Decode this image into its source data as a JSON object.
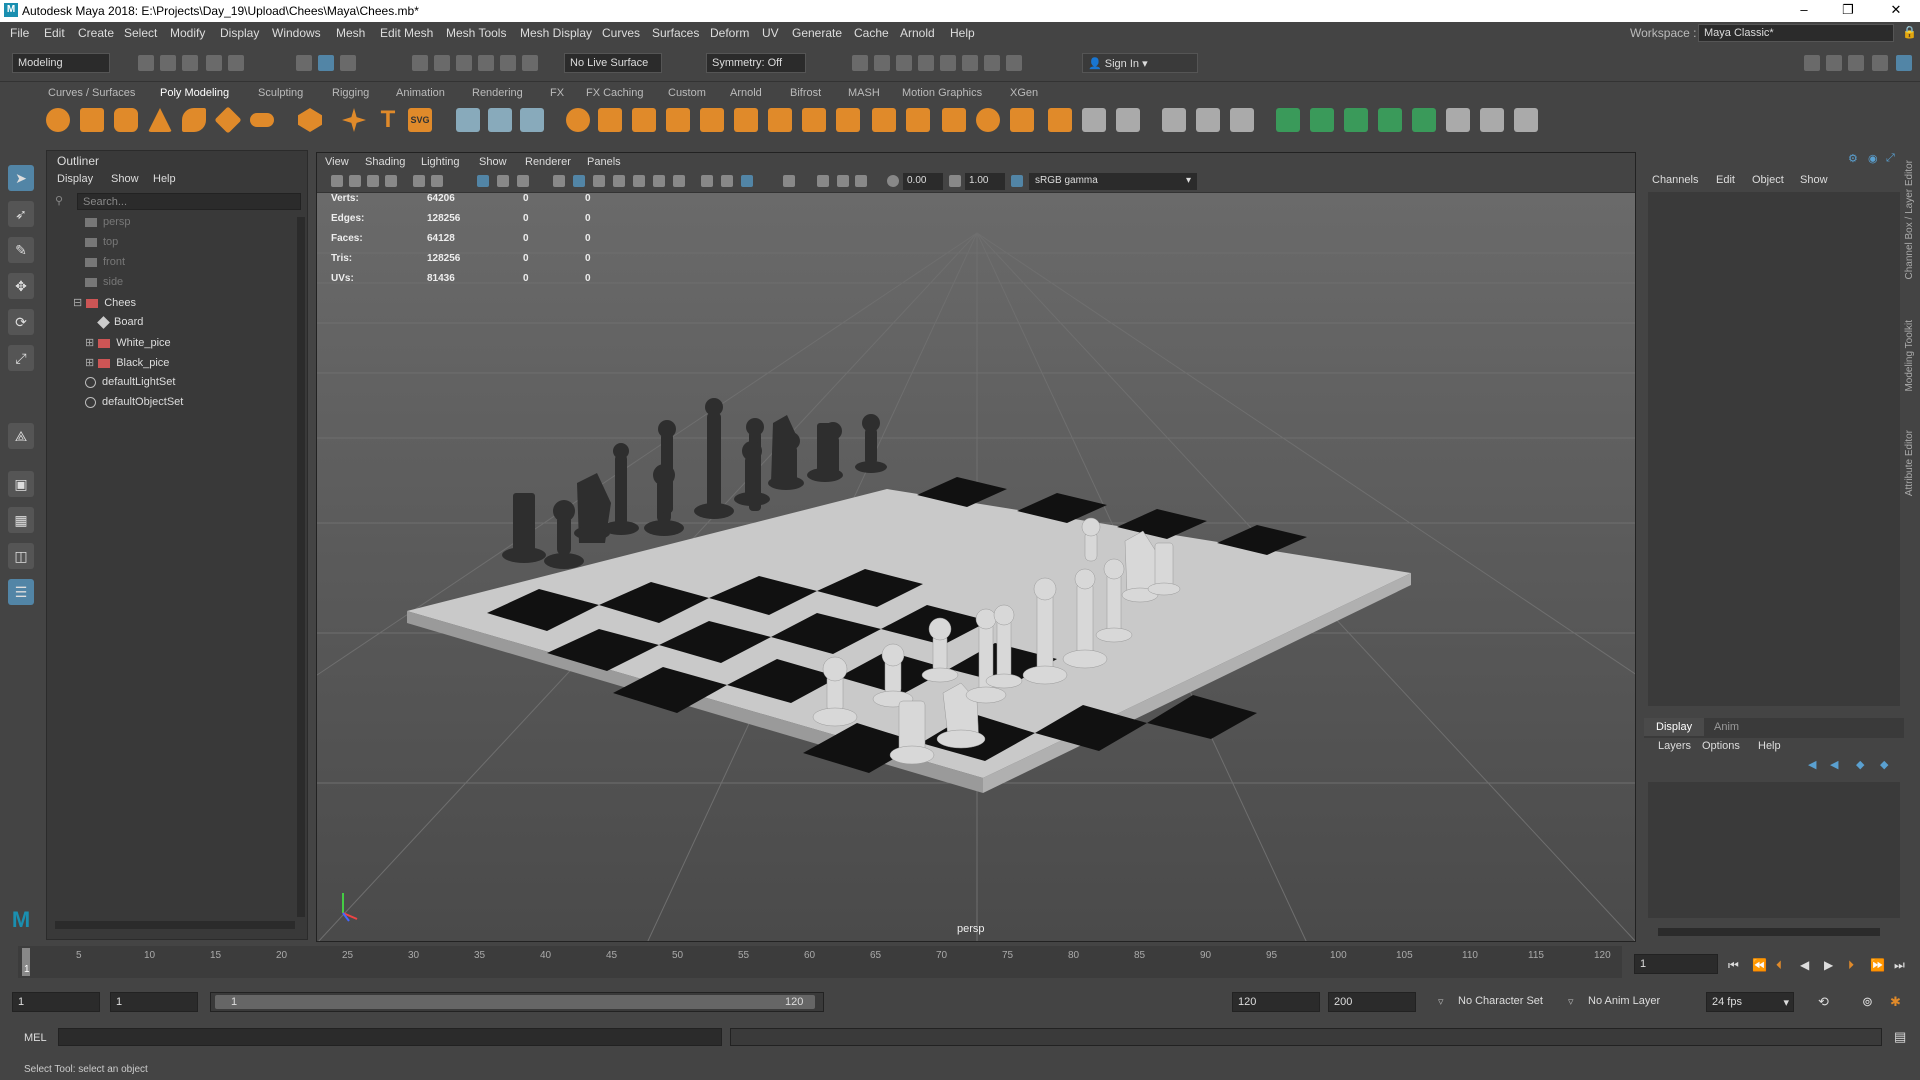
{
  "title": "Autodesk Maya 2018: E:\\Projects\\Day_19\\Upload\\Chees\\Maya\\Chees.mb*",
  "menus": [
    "File",
    "Edit",
    "Create",
    "Select",
    "Modify",
    "Display",
    "Windows",
    "Mesh",
    "Edit Mesh",
    "Mesh Tools",
    "Mesh Display",
    "Curves",
    "Surfaces",
    "Deform",
    "UV",
    "Generate",
    "Cache",
    "Arnold",
    "Help"
  ],
  "workspace": {
    "label": "Workspace :",
    "value": "Maya Classic*"
  },
  "toolbar": {
    "mode": "Modeling",
    "live_surface": "No Live Surface",
    "symmetry": "Symmetry: Off",
    "sign_in": "Sign In"
  },
  "shelf_tabs": [
    "Curves / Surfaces",
    "Poly Modeling",
    "Sculpting",
    "Rigging",
    "Animation",
    "Rendering",
    "FX",
    "FX Caching",
    "Custom",
    "Arnold",
    "Bifrost",
    "MASH",
    "Motion Graphics",
    "XGen"
  ],
  "outliner": {
    "title": "Outliner",
    "menus": [
      "Display",
      "Show",
      "Help"
    ],
    "search_placeholder": "Search...",
    "items": [
      "persp",
      "top",
      "front",
      "side",
      "Chees",
      "Board",
      "White_pice",
      "Black_pice",
      "defaultLightSet",
      "defaultObjectSet"
    ]
  },
  "viewport": {
    "menus": [
      "View",
      "Shading",
      "Lighting",
      "Show",
      "Renderer",
      "Panels"
    ],
    "exposure": "0.00",
    "gamma": "1.00",
    "color_space": "sRGB gamma",
    "camera": "persp",
    "hud": [
      {
        "label": "Verts:",
        "a": "64206",
        "b": "0",
        "c": "0"
      },
      {
        "label": "Edges:",
        "a": "128256",
        "b": "0",
        "c": "0"
      },
      {
        "label": "Faces:",
        "a": "64128",
        "b": "0",
        "c": "0"
      },
      {
        "label": "Tris:",
        "a": "128256",
        "b": "0",
        "c": "0"
      },
      {
        "label": "UVs:",
        "a": "81436",
        "b": "0",
        "c": "0"
      }
    ]
  },
  "channel_box": {
    "menus": [
      "Channels",
      "Edit",
      "Object",
      "Show"
    ]
  },
  "layer_editor": {
    "tabs": [
      "Display",
      "Anim"
    ],
    "menus": [
      "Layers",
      "Options",
      "Help"
    ]
  },
  "side_tabs": [
    "Channel Box / Layer Editor",
    "Modeling Toolkit",
    "Attribute Editor"
  ],
  "timeline": {
    "ticks": [
      "5",
      "10",
      "15",
      "20",
      "25",
      "30",
      "35",
      "40",
      "45",
      "50",
      "55",
      "60",
      "65",
      "70",
      "75",
      "80",
      "85",
      "90",
      "95",
      "100",
      "105",
      "110",
      "115",
      "120"
    ],
    "start_label": "1",
    "current": "1"
  },
  "range": {
    "start": "1",
    "anim_start": "1",
    "slider_start": "1",
    "slider_end": "120",
    "end": "120",
    "anim_end": "200",
    "character_set": "No Character Set",
    "anim_layer": "No Anim Layer",
    "fps": "24 fps"
  },
  "command": {
    "lang": "MEL"
  },
  "help_line": "Select Tool: select an object",
  "colors": {
    "accent": "#5285a6",
    "bg": "#444444",
    "viewport": "#5b5b5b"
  }
}
